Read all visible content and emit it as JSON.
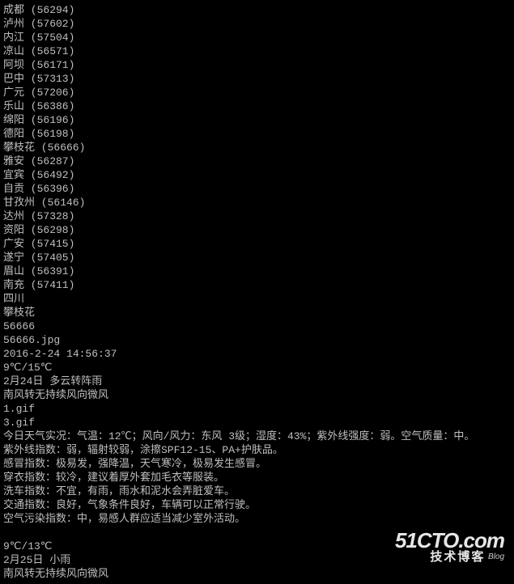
{
  "cities": [
    {
      "name": "成都",
      "code": "56294"
    },
    {
      "name": "泸州",
      "code": "57602"
    },
    {
      "name": "内江",
      "code": "57504"
    },
    {
      "name": "凉山",
      "code": "56571"
    },
    {
      "name": "阿坝",
      "code": "56171"
    },
    {
      "name": "巴中",
      "code": "57313"
    },
    {
      "name": "广元",
      "code": "57206"
    },
    {
      "name": "乐山",
      "code": "56386"
    },
    {
      "name": "绵阳",
      "code": "56196"
    },
    {
      "name": "德阳",
      "code": "56198"
    },
    {
      "name": "攀枝花",
      "code": "56666"
    },
    {
      "name": "雅安",
      "code": "56287"
    },
    {
      "name": "宜宾",
      "code": "56492"
    },
    {
      "name": "自贡",
      "code": "56396"
    },
    {
      "name": "甘孜州",
      "code": "56146"
    },
    {
      "name": "达州",
      "code": "57328"
    },
    {
      "name": "资阳",
      "code": "56298"
    },
    {
      "name": "广安",
      "code": "57415"
    },
    {
      "name": "遂宁",
      "code": "57405"
    },
    {
      "name": "眉山",
      "code": "56391"
    },
    {
      "name": "南充",
      "code": "57411"
    }
  ],
  "province": "四川",
  "selected_city": "攀枝花",
  "selected_code": "56666",
  "image_file": "56666.jpg",
  "datetime": "2016-2-24 14:56:37",
  "today": {
    "temp": "9℃/15℃",
    "date_weather": "2月24日 多云转阵雨",
    "wind": "南风转无持续风向微风",
    "icon1": "1.gif",
    "icon3": "3.gif",
    "desc": "今日天气实况：气温：12℃；风向/风力：东风 3级；湿度：43%；紫外线强度：弱。空气质量：中。",
    "uv": "紫外线指数：弱，辐射较弱，涂擦SPF12-15、PA+护肤品。",
    "cold": "感冒指数：极易发，强降温，天气寒冷，极易发生感冒。",
    "wear": "穿衣指数：较冷，建议着厚外套加毛衣等服装。",
    "car": "洗车指数：不宜，有雨，雨水和泥水会弄脏爱车。",
    "traffic": "交通指数：良好，气象条件良好，车辆可以正常行驶。",
    "air": "空气污染指数：中，易感人群应适当减少室外活动。"
  },
  "tomorrow": {
    "temp": "9℃/13℃",
    "date_weather": "2月25日 小雨",
    "wind": "南风转无持续风向微风"
  },
  "logo": {
    "brand": "51CTO",
    "tld": ".com",
    "cn": "技术博客",
    "tag": "Blog"
  }
}
